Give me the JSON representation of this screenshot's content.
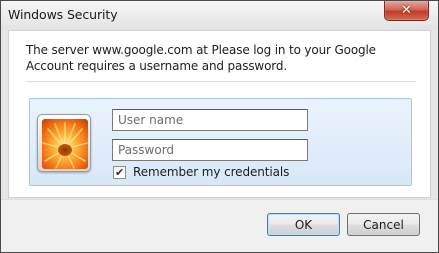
{
  "window": {
    "title": "Windows Security",
    "close_symbol": "✕"
  },
  "dialog": {
    "message": "The server www.google.com at Please log in to your Google Account requires a username and password."
  },
  "credentials": {
    "avatar_icon": "user-tile-flower-icon",
    "username": {
      "value": "",
      "placeholder": "User name"
    },
    "password": {
      "value": "",
      "placeholder": "Password"
    },
    "remember": {
      "label": "Remember my credentials",
      "checked": true,
      "check_symbol": "✔"
    }
  },
  "buttons": {
    "ok_label": "OK",
    "cancel_label": "Cancel"
  },
  "colors": {
    "tile_border": "#a9c6e8",
    "tile_background": "#d8e8f8",
    "close_button": "#c23a2a",
    "default_button_border": "#3c7fb1"
  }
}
